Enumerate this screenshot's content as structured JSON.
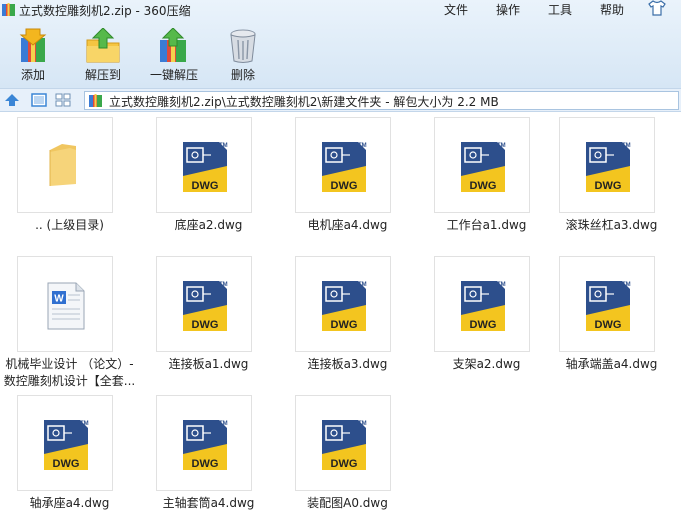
{
  "window": {
    "title": "立式数控雕刻机2.zip - 360压缩"
  },
  "menu": {
    "file": "文件",
    "operation": "操作",
    "tools": "工具",
    "help": "帮助"
  },
  "toolbar": {
    "add": "添加",
    "extract_to": "解压到",
    "one_click_extract": "一键解压",
    "delete": "删除"
  },
  "address": {
    "path": "立式数控雕刻机2.zip\\立式数控雕刻机2\\新建文件夹 - 解包大小为 2.2 MB"
  },
  "files": [
    {
      "name": ".. (上级目录)",
      "type": "folder"
    },
    {
      "name": "底座a2.dwg",
      "type": "dwg"
    },
    {
      "name": "电机座a4.dwg",
      "type": "dwg"
    },
    {
      "name": "工作台a1.dwg",
      "type": "dwg"
    },
    {
      "name": "滚珠丝杠a3.dwg",
      "type": "dwg"
    },
    {
      "name": "机械毕业设计 （论文）-",
      "name2": "数控雕刻机设计【全套...",
      "type": "doc"
    },
    {
      "name": "连接板a1.dwg",
      "type": "dwg"
    },
    {
      "name": "连接板a3.dwg",
      "type": "dwg"
    },
    {
      "name": "支架a2.dwg",
      "type": "dwg"
    },
    {
      "name": "轴承端盖a4.dwg",
      "type": "dwg"
    },
    {
      "name": "轴承座a4.dwg",
      "type": "dwg"
    },
    {
      "name": "主轴套筒a4.dwg",
      "type": "dwg"
    },
    {
      "name": "装配图A0.dwg",
      "type": "dwg"
    }
  ],
  "icons": {
    "dwg_label": "DWG",
    "tm": "TM"
  }
}
